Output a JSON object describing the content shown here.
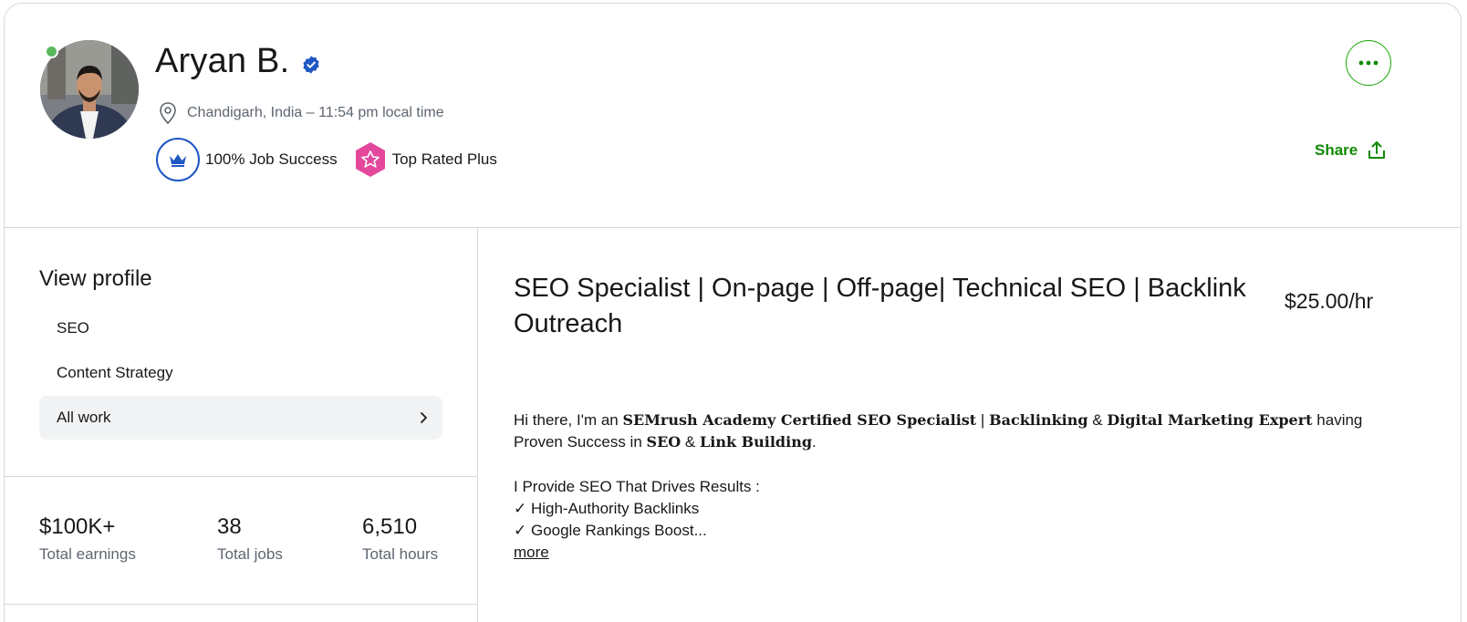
{
  "profile": {
    "name": "Aryan B.",
    "location": "Chandigarh, India – 11:54 pm local time",
    "badges": {
      "job_success": "100% Job Success",
      "top_rated": "Top Rated Plus"
    },
    "share_label": "Share",
    "online": true,
    "icons": {
      "verified": "verified-check-icon",
      "location": "location-pin-icon",
      "job_success": "crown-icon",
      "top_rated": "star-badge-icon",
      "more": "ellipsis-icon",
      "share": "share-upload-icon"
    }
  },
  "sidebar": {
    "heading": "View profile",
    "items": [
      {
        "label": "SEO"
      },
      {
        "label": "Content Strategy"
      },
      {
        "label": "All work"
      }
    ]
  },
  "stats": [
    {
      "value": "$100K+",
      "label": "Total earnings"
    },
    {
      "value": "38",
      "label": "Total jobs"
    },
    {
      "value": "6,510",
      "label": "Total hours"
    }
  ],
  "main": {
    "title": "SEO Specialist | On-page | Off-page| Technical SEO | Backlink Outreach",
    "rate": "$25.00/hr",
    "bio": {
      "p1_a": "Hi there, I'm an ",
      "p1_b": "SEMrush Academy Certified SEO Specialist",
      "p1_c": " | ",
      "p1_d": "Backlinking",
      "p1_e": " & ",
      "p1_f": "Digital Marketing Expert",
      "p1_g": " having Proven Success in ",
      "p1_h": "SEO",
      "p1_i": " & ",
      "p1_j": "Link Building",
      "p1_k": ".",
      "line2": "I Provide SEO That Drives Results :",
      "line3": "✓ High-Authority Backlinks",
      "line4": "✓ Google Rankings Boost..."
    },
    "more_label": "more"
  },
  "colors": {
    "accent_green": "#108a00",
    "badge_blue": "#1f57c3",
    "badge_pink": "#e3489d",
    "online_green": "#5cb85c"
  }
}
